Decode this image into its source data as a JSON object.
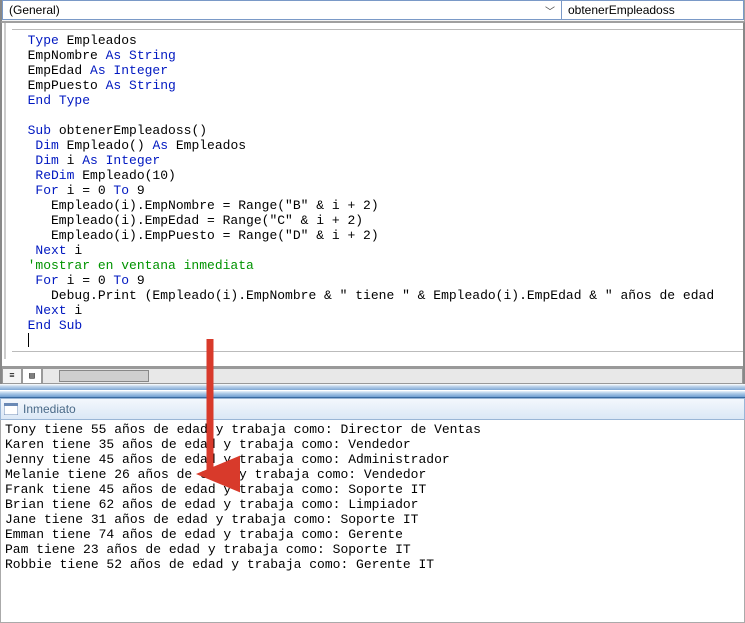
{
  "toolbar": {
    "left_dropdown_value": "(General)",
    "right_dropdown_value": "obtenerEmpleadoss"
  },
  "code": {
    "l1": {
      "a": "Type",
      "b": " Empleados"
    },
    "l2": {
      "a": "  EmpNombre ",
      "b": "As String"
    },
    "l3": {
      "a": "  EmpEdad ",
      "b": "As Integer"
    },
    "l4": {
      "a": "  EmpPuesto ",
      "b": "As String"
    },
    "l5": {
      "a": "End Type"
    },
    "l6": {
      "a": "Sub",
      "b": " obtenerEmpleadoss()"
    },
    "l7": {
      "a": "   Dim",
      "b": " Empleado() ",
      "c": "As",
      "d": " Empleados"
    },
    "l8": {
      "a": "   Dim",
      "b": " i ",
      "c": "As Integer"
    },
    "l9": {
      "a": "   ReDim",
      "b": " Empleado(10)"
    },
    "l10": {
      "a": "   For",
      "b": " i = 0 ",
      "c": "To",
      "d": " 9"
    },
    "l11": {
      "a": "     Empleado(i).EmpNombre = Range(\"B\" & i + 2)"
    },
    "l12": {
      "a": "     Empleado(i).EmpEdad = Range(\"C\" & i + 2)"
    },
    "l13": {
      "a": "     Empleado(i).EmpPuesto = Range(\"D\" & i + 2)"
    },
    "l14": {
      "a": "   Next",
      "b": " i"
    },
    "l15": {
      "a": "  'mostrar en ventana inmediata"
    },
    "l16": {
      "a": "   For",
      "b": " i = 0 ",
      "c": "To",
      "d": " 9"
    },
    "l17": {
      "a": "     Debug.Print (Empleado(i).EmpNombre & \" tiene \" & Empleado(i).EmpEdad & \" años de edad"
    },
    "l18": {
      "a": "   Next",
      "b": " i"
    },
    "l19": {
      "a": "End Sub"
    }
  },
  "immediate": {
    "title": "Inmediato",
    "lines": [
      "Tony tiene 55 años de edad y trabaja como: Director de Ventas",
      "Karen tiene 35 años de edad y trabaja como: Vendedor",
      "Jenny tiene 45 años de edad y trabaja como: Administrador",
      "Melanie tiene 26 años de edad y trabaja como: Vendedor",
      "Frank tiene 45 años de edad y trabaja como: Soporte IT",
      "Brian tiene 62 años de edad y trabaja como: Limpiador",
      "Jane tiene 31 años de edad y trabaja como: Soporte IT",
      "Emman tiene 74 años de edad y trabaja como: Gerente",
      "Pam tiene 23 años de edad y trabaja como: Soporte IT",
      "Robbie tiene 52 años de edad y trabaja como: Gerente IT"
    ]
  }
}
